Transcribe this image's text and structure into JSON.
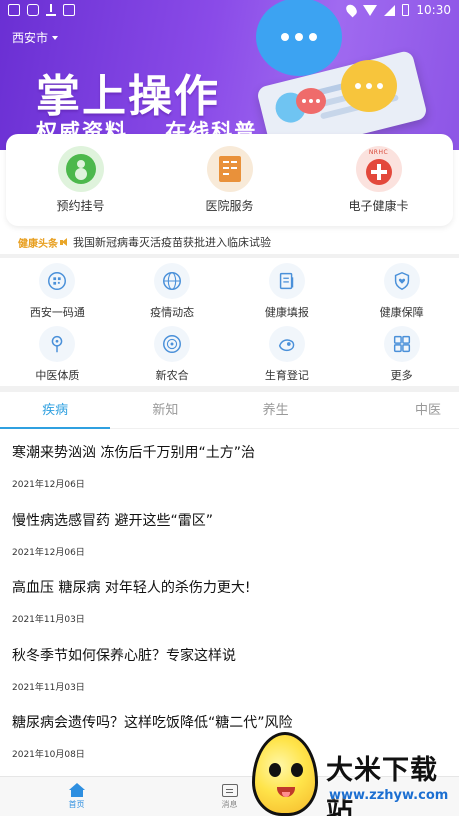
{
  "status_bar": {
    "time": "10:30"
  },
  "header": {
    "city": "西安市"
  },
  "banner": {
    "title": "掌上操作",
    "subtitle": "权威资料    在线科普"
  },
  "quick_services": [
    {
      "label": "预约挂号",
      "icon": "register-icon"
    },
    {
      "label": "医院服务",
      "icon": "hospital-icon"
    },
    {
      "label": "电子健康卡",
      "icon": "health-card-icon",
      "badge_text": "NRHC"
    }
  ],
  "headline": {
    "tag": "健康头条",
    "text": "我国新冠病毒灭活疫苗获批进入临床试验"
  },
  "grid": [
    {
      "label": "西安一码通",
      "icon": "qr-code-icon"
    },
    {
      "label": "疫情动态",
      "icon": "globe-icon"
    },
    {
      "label": "健康填报",
      "icon": "form-icon"
    },
    {
      "label": "健康保障",
      "icon": "shield-heart-icon"
    },
    {
      "label": "中医体质",
      "icon": "body-icon"
    },
    {
      "label": "新农合",
      "icon": "badge-icon"
    },
    {
      "label": "生育登记",
      "icon": "baby-icon"
    },
    {
      "label": "更多",
      "icon": "more-grid-icon"
    }
  ],
  "tabs": [
    {
      "label": "疾病",
      "active": true
    },
    {
      "label": "新知",
      "active": false
    },
    {
      "label": "养生",
      "active": false
    },
    {
      "label": "中医",
      "active": false
    }
  ],
  "articles": [
    {
      "title": "寒潮来势汹汹 冻伤后千万别用“土方”治",
      "date": "2021年12月06日"
    },
    {
      "title": "慢性病选感冒药 避开这些“雷区”",
      "date": "2021年12月06日"
    },
    {
      "title": "高血压 糖尿病 对年轻人的杀伤力更大!",
      "date": "2021年11月03日"
    },
    {
      "title": "秋冬季节如何保养心脏？专家这样说",
      "date": "2021年11月03日"
    },
    {
      "title": "糖尿病会遗传吗？这样吃饭降低“糖二代”风险",
      "date": "2021年10月08日"
    }
  ],
  "bottom_nav": [
    {
      "label": "首页",
      "icon": "home-icon",
      "active": true
    },
    {
      "label": "消息",
      "icon": "message-icon",
      "active": false
    }
  ],
  "watermark": {
    "title": "大米下载站",
    "url": "www.zzhyw.com"
  },
  "colors": {
    "banner_purple": "#7b3fe0",
    "accent_blue": "#2fa0e0",
    "headline_orange": "#e89f20"
  }
}
